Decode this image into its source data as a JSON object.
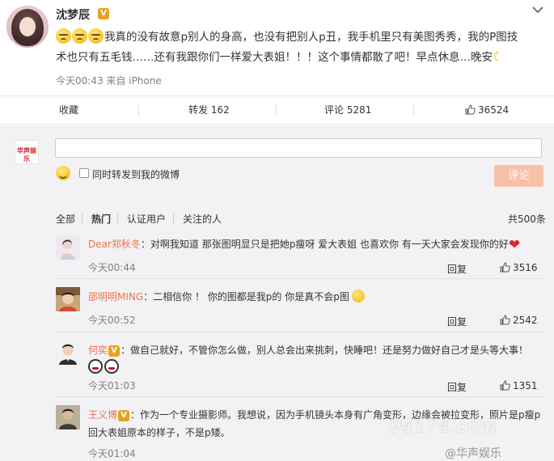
{
  "post": {
    "author": "沈梦辰",
    "verified_badge": "V",
    "text_line1": "我真的没有故意p别人的身高，也没有把别人p丑，我手机里只有美图秀秀，我的P图技",
    "text_line2": "术也只有五毛钱……还有我跟你们一样爱大表姐！！！这个事情都散了吧！早点休息…晚安",
    "emoji_count": 3,
    "time": "今天00:43",
    "source": "来自 iPhone",
    "menu_icon": "chevron-down-icon"
  },
  "actions": {
    "favorite": "收藏",
    "repost": "转发 162",
    "comment": "评论 5281",
    "likes": "36524"
  },
  "comment_box": {
    "logo_line1": "华声",
    "logo_line2": "娱乐",
    "placeholder": "",
    "also_repost_label": "同时转发到我的微博",
    "submit_label": "评论"
  },
  "tabs": {
    "all": "全部",
    "hot": "热门",
    "verified": "认证用户",
    "following": "关注的人",
    "total": "共500条"
  },
  "comments": [
    {
      "user": "Dear郑秋冬",
      "text": "：对啊我知道 那张图明显只是把她p瘦呀 爱大表姐 也喜欢你 有一天大家会发现你的好",
      "time": "今天00:44",
      "reply": "回复",
      "likes": "3516"
    },
    {
      "user": "邵明明MING",
      "text": "：二相信你 ！ 你的图都是我p的 你是真不会p图",
      "time": "今天00:52",
      "reply": "回复",
      "likes": "2542"
    },
    {
      "user": "何奕",
      "text": "：做自己就好，不管你怎么做，别人总会出来挑刺，快睡吧！还是努力做好自己才是头等大事！",
      "time": "今天01:03",
      "reply": "回复",
      "likes": "1351"
    },
    {
      "user": "王义博",
      "text_line1": "：作为一个专业摄影师。我想说，因为手机镜头本身有广角变形，边缘会被拉变形，照片是p瘦p",
      "text_line2": "回大表姐原本的样子，不是p矮。",
      "time": "今天01:04"
    }
  ],
  "watermark": "94174.com",
  "watermark2": "@华声娱乐"
}
